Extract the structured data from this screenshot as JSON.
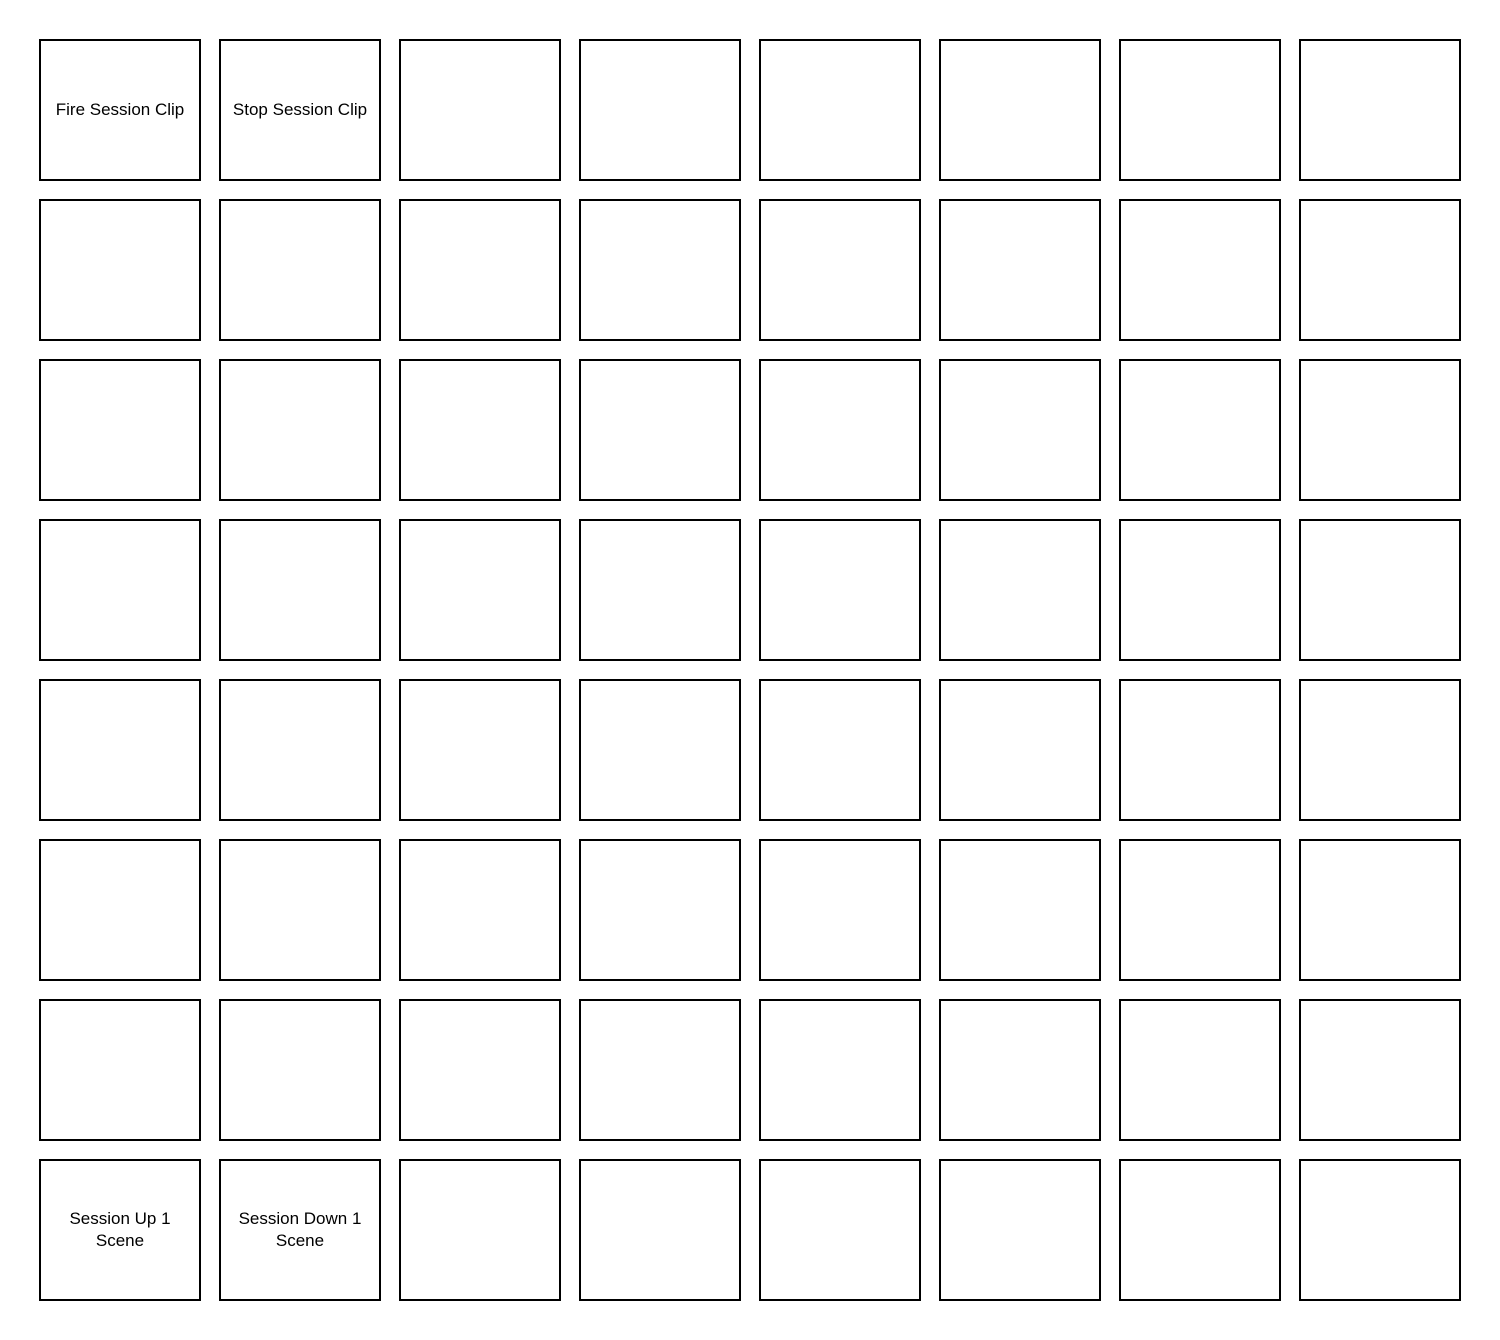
{
  "grid": {
    "rows": 8,
    "columns": 8,
    "pads": [
      {
        "label": "Fire Session Clip"
      },
      {
        "label": "Stop Session Clip"
      },
      {
        "label": ""
      },
      {
        "label": ""
      },
      {
        "label": ""
      },
      {
        "label": ""
      },
      {
        "label": ""
      },
      {
        "label": ""
      },
      {
        "label": ""
      },
      {
        "label": ""
      },
      {
        "label": ""
      },
      {
        "label": ""
      },
      {
        "label": ""
      },
      {
        "label": ""
      },
      {
        "label": ""
      },
      {
        "label": ""
      },
      {
        "label": ""
      },
      {
        "label": ""
      },
      {
        "label": ""
      },
      {
        "label": ""
      },
      {
        "label": ""
      },
      {
        "label": ""
      },
      {
        "label": ""
      },
      {
        "label": ""
      },
      {
        "label": ""
      },
      {
        "label": ""
      },
      {
        "label": ""
      },
      {
        "label": ""
      },
      {
        "label": ""
      },
      {
        "label": ""
      },
      {
        "label": ""
      },
      {
        "label": ""
      },
      {
        "label": ""
      },
      {
        "label": ""
      },
      {
        "label": ""
      },
      {
        "label": ""
      },
      {
        "label": ""
      },
      {
        "label": ""
      },
      {
        "label": ""
      },
      {
        "label": ""
      },
      {
        "label": ""
      },
      {
        "label": ""
      },
      {
        "label": ""
      },
      {
        "label": ""
      },
      {
        "label": ""
      },
      {
        "label": ""
      },
      {
        "label": ""
      },
      {
        "label": ""
      },
      {
        "label": ""
      },
      {
        "label": ""
      },
      {
        "label": ""
      },
      {
        "label": ""
      },
      {
        "label": ""
      },
      {
        "label": ""
      },
      {
        "label": ""
      },
      {
        "label": ""
      },
      {
        "label": "Session Up 1\nScene"
      },
      {
        "label": "Session Down 1\nScene"
      },
      {
        "label": ""
      },
      {
        "label": ""
      },
      {
        "label": ""
      },
      {
        "label": ""
      },
      {
        "label": ""
      },
      {
        "label": ""
      }
    ]
  }
}
